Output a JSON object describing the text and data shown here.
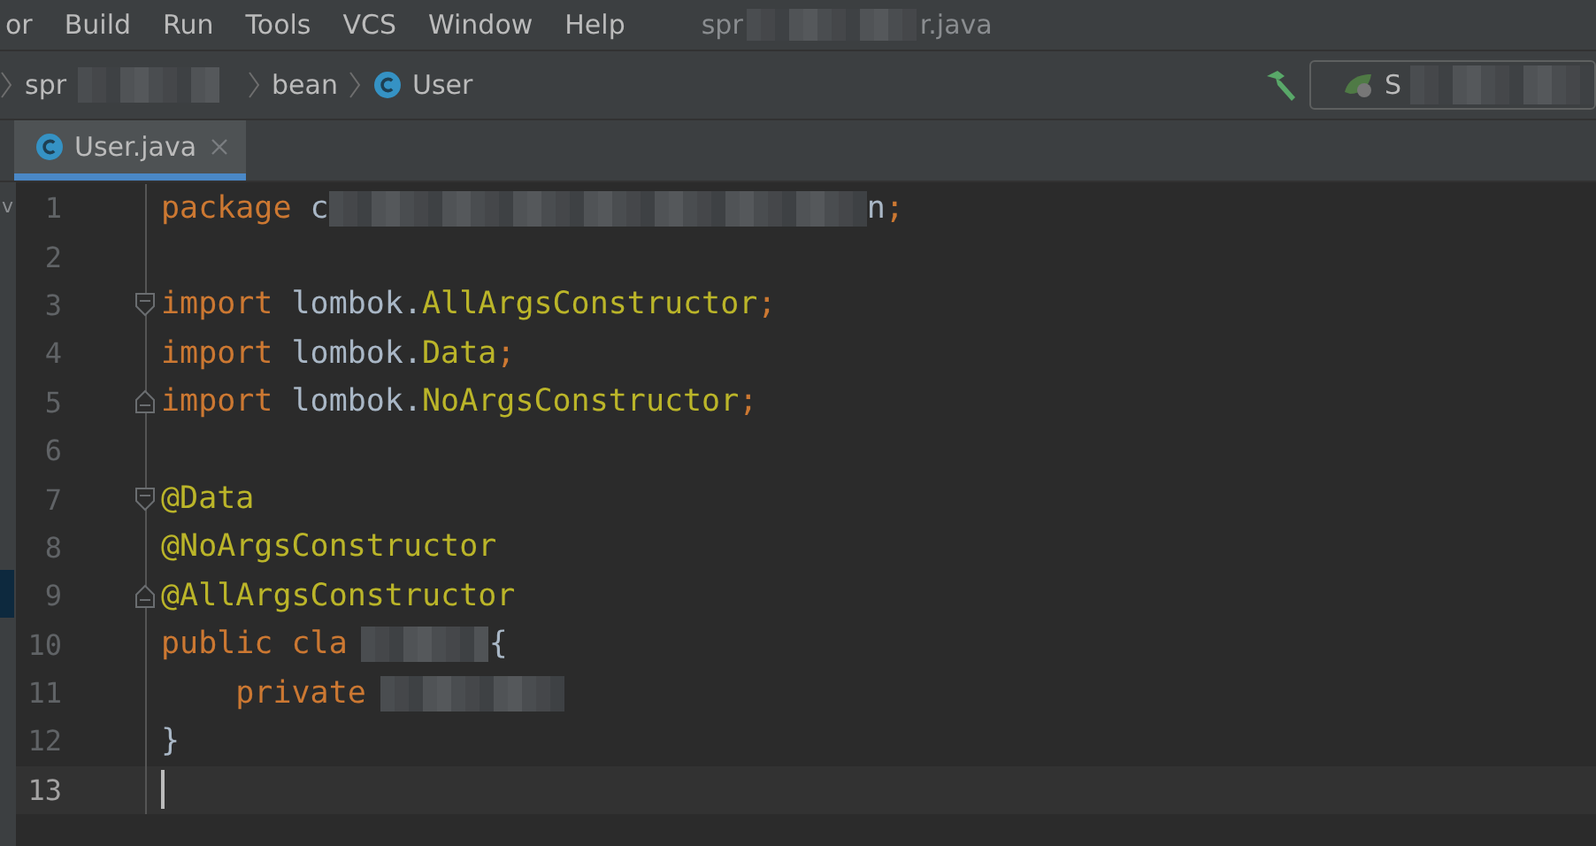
{
  "menu": [
    {
      "label": "or"
    },
    {
      "label": "Build"
    },
    {
      "label": "Run"
    },
    {
      "label": "Tools"
    },
    {
      "label": "VCS"
    },
    {
      "label": "Window"
    },
    {
      "label": "Help"
    }
  ],
  "window": {
    "title_parts": [
      "spr",
      "r.java"
    ]
  },
  "breadcrumbs": [
    {
      "label": "spr",
      "kind": "folder"
    },
    {
      "label": "bean",
      "kind": "folder"
    },
    {
      "label": "User",
      "kind": "class"
    }
  ],
  "run_config": {
    "label": "S"
  },
  "tabs": [
    {
      "label": "User.java",
      "selected": true
    }
  ],
  "side_panel": {
    "label": "v"
  },
  "editor": {
    "lines": [
      {
        "number": "1",
        "fold_start": false,
        "fold_end": false,
        "current": false,
        "tokens": [
          {
            "kind": "keyword",
            "text": "package"
          },
          {
            "kind": "plain",
            "text": " c"
          },
          {
            "kind": "redacted"
          },
          {
            "kind": "plain",
            "text": "n"
          },
          {
            "kind": "keyword",
            "text": ";"
          }
        ]
      },
      {
        "number": "2",
        "fold_start": false,
        "fold_end": false,
        "current": false
      },
      {
        "number": "3",
        "fold_start": true,
        "fold_end": false,
        "current": false,
        "tokens": [
          {
            "kind": "keyword",
            "text": "import"
          },
          {
            "kind": "plain",
            "text": " lombok."
          },
          {
            "kind": "annotation",
            "text": "AllArgsConstructor"
          },
          {
            "kind": "keyword",
            "text": ";"
          }
        ]
      },
      {
        "number": "4",
        "fold_start": false,
        "fold_end": false,
        "current": false,
        "tokens": [
          {
            "kind": "keyword",
            "text": "import"
          },
          {
            "kind": "plain",
            "text": " lombok."
          },
          {
            "kind": "annotation",
            "text": "Data"
          },
          {
            "kind": "keyword",
            "text": ";"
          }
        ]
      },
      {
        "number": "5",
        "fold_start": false,
        "fold_end": true,
        "current": false,
        "tokens": [
          {
            "kind": "keyword",
            "text": "import"
          },
          {
            "kind": "plain",
            "text": " lombok."
          },
          {
            "kind": "annotation",
            "text": "NoArgsConstructor"
          },
          {
            "kind": "keyword",
            "text": ";"
          }
        ]
      },
      {
        "number": "6",
        "fold_start": false,
        "fold_end": false,
        "current": false
      },
      {
        "number": "7",
        "fold_start": true,
        "fold_end": false,
        "current": false,
        "tokens": [
          {
            "kind": "annotation",
            "text": "@Data"
          }
        ]
      },
      {
        "number": "8",
        "fold_start": false,
        "fold_end": false,
        "current": false,
        "tokens": [
          {
            "kind": "annotation",
            "text": "@NoArgsConstructor"
          }
        ]
      },
      {
        "number": "9",
        "fold_start": false,
        "fold_end": true,
        "current": false,
        "tokens": [
          {
            "kind": "annotation",
            "text": "@AllArgsConstructor"
          }
        ]
      },
      {
        "number": "10",
        "fold_start": false,
        "fold_end": false,
        "current": false,
        "tokens": [
          {
            "kind": "keyword",
            "text": "public cla"
          },
          {
            "kind": "redacted"
          },
          {
            "kind": "plain",
            "text": "{"
          }
        ]
      },
      {
        "number": "11",
        "fold_start": false,
        "fold_end": false,
        "current": false,
        "tokens": [
          {
            "kind": "keyword",
            "text": "    private"
          },
          {
            "kind": "redacted"
          }
        ]
      },
      {
        "number": "12",
        "fold_start": false,
        "fold_end": false,
        "current": false,
        "tokens": [
          {
            "kind": "plain",
            "text": "}"
          }
        ]
      },
      {
        "number": "13",
        "fold_start": false,
        "fold_end": false,
        "current": true
      }
    ]
  }
}
